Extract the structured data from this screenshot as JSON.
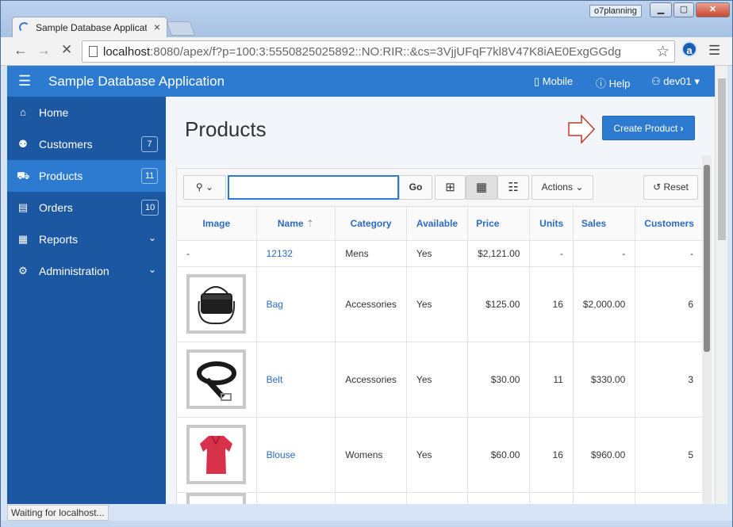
{
  "browser": {
    "tab_title": "Sample Database Applicat",
    "tab_close": "×",
    "profile": "o7planning",
    "url_host": "localhost",
    "url_rest": ":8080/apex/f?p=100:3:5550825025892::NO:RIR::&cs=3VjjUFqF7kl8V47K8iAE0ExgGGdg",
    "status": "Waiting for localhost...",
    "extension_label": "a"
  },
  "header": {
    "app_title": "Sample Database Application",
    "mobile": "Mobile",
    "help": "Help",
    "user": "dev01"
  },
  "sidebar": {
    "items": [
      {
        "label": "Home",
        "badge": "",
        "icon": "home-icon"
      },
      {
        "label": "Customers",
        "badge": "7",
        "icon": "users-icon"
      },
      {
        "label": "Products",
        "badge": "11",
        "icon": "cart-icon"
      },
      {
        "label": "Orders",
        "badge": "10",
        "icon": "orders-icon"
      },
      {
        "label": "Reports",
        "badge": "",
        "icon": "table-icon"
      },
      {
        "label": "Administration",
        "badge": "",
        "icon": "gear-icon"
      }
    ]
  },
  "page": {
    "title": "Products",
    "create_button": "Create Product"
  },
  "report": {
    "search_placeholder": "",
    "go_label": "Go",
    "actions_label": "Actions",
    "reset_label": "Reset",
    "columns": [
      "Image",
      "Name",
      "Category",
      "Available",
      "Price",
      "Units",
      "Sales",
      "Customers"
    ],
    "rows": [
      {
        "image": "-",
        "name": "12132",
        "category": "Mens",
        "available": "Yes",
        "price": "$2,121.00",
        "units": "-",
        "sales": "-",
        "customers": "-"
      },
      {
        "image": "bag",
        "name": "Bag",
        "category": "Accessories",
        "available": "Yes",
        "price": "$125.00",
        "units": "16",
        "sales": "$2,000.00",
        "customers": "6"
      },
      {
        "image": "belt",
        "name": "Belt",
        "category": "Accessories",
        "available": "Yes",
        "price": "$30.00",
        "units": "11",
        "sales": "$330.00",
        "customers": "3"
      },
      {
        "image": "blouse",
        "name": "Blouse",
        "category": "Womens",
        "available": "Yes",
        "price": "$60.00",
        "units": "16",
        "sales": "$960.00",
        "customers": "5"
      }
    ]
  },
  "colors": {
    "header_blue": "#2d7bd0",
    "sidebar_blue": "#1c57a2",
    "link_blue": "#2d6bbd"
  }
}
